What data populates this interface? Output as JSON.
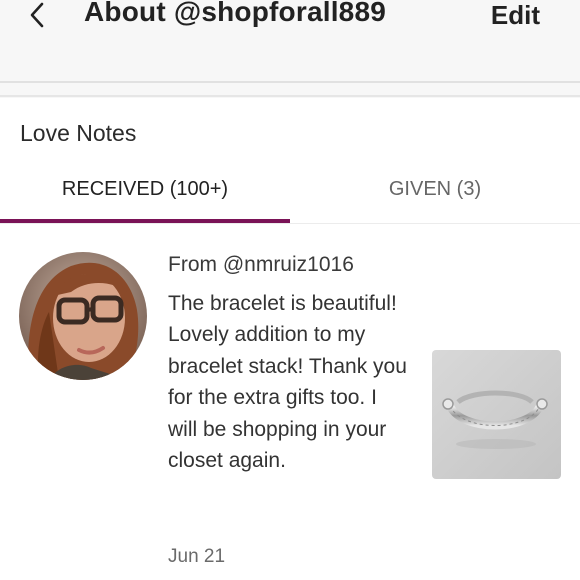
{
  "header": {
    "title": "About @shopforall889",
    "edit_label": "Edit",
    "back_icon": "chevron-left-icon"
  },
  "section": {
    "title": "Love Notes"
  },
  "tabs": [
    {
      "label": "RECEIVED (100+)",
      "active": true
    },
    {
      "label": "GIVEN (3)",
      "active": false
    }
  ],
  "accent_color": "#7a1357",
  "note": {
    "from": "From @nmruiz1016",
    "body": "The bracelet is beautiful! Lovely addition to my bracelet stack! Thank you for the extra gifts too. I will be shopping in your closet again.",
    "date": "Jun 21",
    "avatar": "user-avatar-photo",
    "product_image": "bracelet-product-photo"
  }
}
